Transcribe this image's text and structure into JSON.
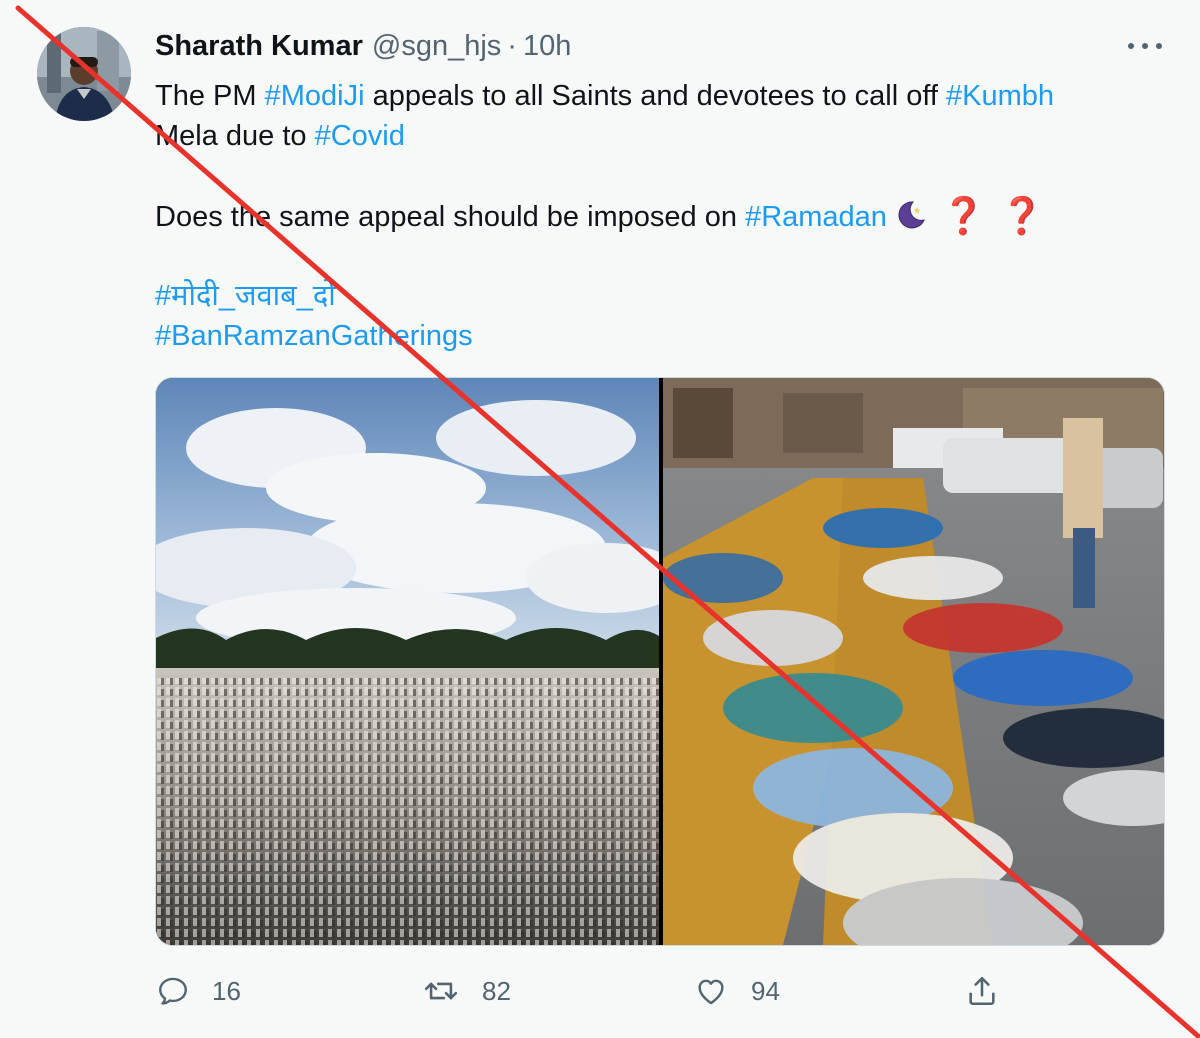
{
  "tweet": {
    "author_name": "Sharath Kumar",
    "author_handle": "@sgn_hjs",
    "separator": "·",
    "time": "10h",
    "text_lines": [
      [
        {
          "t": "The PM ",
          "tag": false
        },
        {
          "t": "#ModiJi",
          "tag": true
        },
        {
          "t": " appeals to all Saints and devotees to call off ",
          "tag": false
        },
        {
          "t": "#Kumbh",
          "tag": true
        }
      ],
      [
        {
          "t": "Mela due to ",
          "tag": false
        },
        {
          "t": "#Covid",
          "tag": true
        }
      ],
      [],
      [
        {
          "t": "Does the same appeal should be imposed on ",
          "tag": false
        },
        {
          "t": "#Ramadan",
          "tag": true
        }
      ],
      [],
      [
        {
          "t": "#मोदी_जवाब_दो",
          "tag": true
        }
      ],
      [
        {
          "t": "#BanRamzanGatherings",
          "tag": true
        }
      ]
    ],
    "emojis": {
      "moon": "crescent-moon-icon",
      "question": "❓"
    },
    "media": [
      {
        "name": "photo-outdoor-prayer-crowd",
        "description_icon": "image"
      },
      {
        "name": "photo-street-prayer-rows",
        "description_icon": "image"
      }
    ],
    "actions": {
      "reply_count": "16",
      "retweet_count": "82",
      "like_count": "94"
    }
  },
  "colors": {
    "link": "#1d9bf0",
    "text": "#0f1419",
    "muted": "#536471",
    "strike": "#e8332c",
    "question": "#d6243a"
  }
}
